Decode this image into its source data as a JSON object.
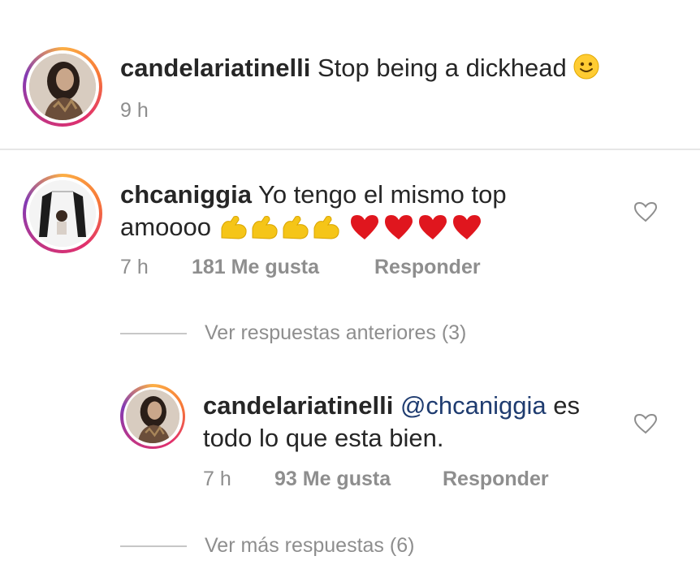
{
  "caption": {
    "username": "candelariatinelli",
    "text": "Stop being a dickhead",
    "emoji": "🙂",
    "time": "9 h"
  },
  "comment1": {
    "username": "chcaniggia",
    "text_line1": "Yo tengo el mismo top",
    "text_line2": "amoooo",
    "emojis": "💪💪💪💪❤️❤️❤️❤️",
    "time": "7 h",
    "likes": "181 Me gusta",
    "reply": "Responder"
  },
  "view_previous": "Ver respuestas anteriores (3)",
  "reply1": {
    "username": "candelariatinelli",
    "mention": "@chcaniggia",
    "text_line1_end": "es",
    "text_line2": "todo lo que esta bien.",
    "time": "7 h",
    "likes": "93 Me gusta",
    "reply": "Responder"
  },
  "view_more": "Ver más respuestas (6)",
  "colors": {
    "text": "#262626",
    "secondary": "#8e8e8e",
    "mention": "#1f3c70",
    "heart_red": "#ed1c24",
    "arm_yellow": "#f5c518"
  },
  "icons": [
    "like-heart-icon",
    "flexed-biceps-emoji",
    "red-heart-emoji",
    "slightly-smiling-face-emoji"
  ]
}
